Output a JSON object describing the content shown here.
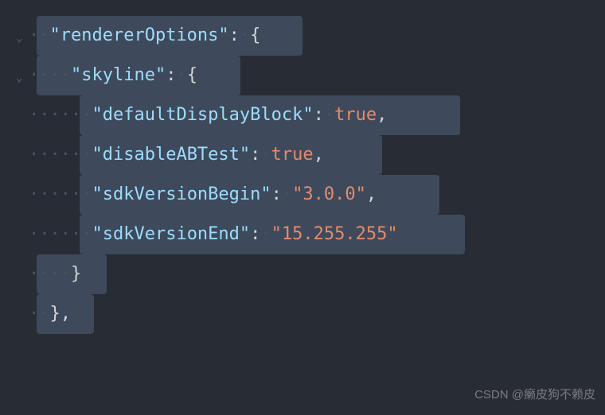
{
  "code": {
    "line1": {
      "ws": "··",
      "key": "\"rendererOptions\"",
      "colon": ":",
      "ws2": "·",
      "brace": "{"
    },
    "line2": {
      "ws": "····",
      "key": "\"skyline\"",
      "colon": ":",
      "ws2": "·",
      "brace": "{"
    },
    "line3": {
      "ws": "······",
      "key": "\"defaultDisplayBlock\"",
      "colon": ":",
      "ws2": "·",
      "val": "true",
      "comma": ","
    },
    "line4": {
      "ws": "······",
      "key": "\"disableABTest\"",
      "colon": ":",
      "ws2": "·",
      "val": "true",
      "comma": ","
    },
    "line5": {
      "ws": "······",
      "key": "\"sdkVersionBegin\"",
      "colon": ":",
      "ws2": "·",
      "val": "\"3.0.0\"",
      "comma": ","
    },
    "line6": {
      "ws": "······",
      "key": "\"sdkVersionEnd\"",
      "colon": ":",
      "ws2": "·",
      "val": "\"15.255.255\""
    },
    "line7": {
      "ws": "····",
      "brace": "}"
    },
    "line8": {
      "ws": "··",
      "brace": "}",
      "comma": ","
    }
  },
  "gutter": {
    "fold1": "⌄",
    "fold2": "⌄"
  },
  "watermark": "CSDN @癞皮狗不赖皮"
}
